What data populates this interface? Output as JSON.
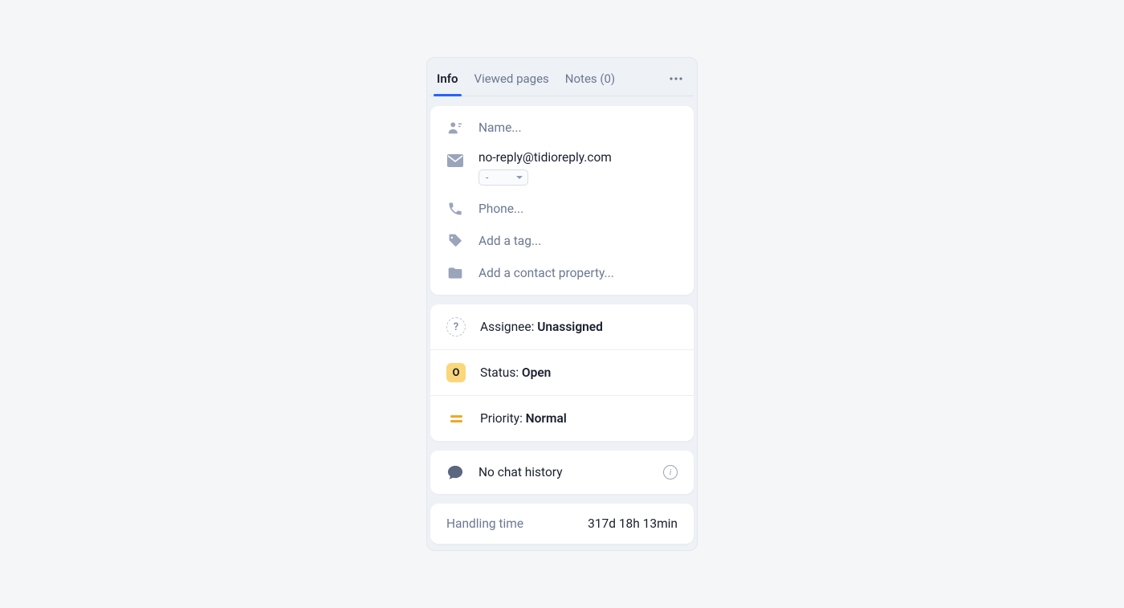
{
  "tabs": {
    "info": "Info",
    "viewed": "Viewed pages",
    "notes": "Notes (0)"
  },
  "contact": {
    "name_placeholder": "Name...",
    "email": "no-reply@tidioreply.com",
    "email_select": "-",
    "phone_placeholder": "Phone...",
    "tag_placeholder": "Add a tag...",
    "property_placeholder": "Add a contact property..."
  },
  "meta": {
    "assignee_label": "Assignee: ",
    "assignee_value": "Unassigned",
    "assignee_badge": "?",
    "status_label": "Status: ",
    "status_value": "Open",
    "status_badge": "O",
    "priority_label": "Priority: ",
    "priority_value": "Normal"
  },
  "chat": {
    "history_text": "No chat history",
    "info_glyph": "i"
  },
  "handling": {
    "label": "Handling time",
    "value": "317d 18h 13min"
  }
}
